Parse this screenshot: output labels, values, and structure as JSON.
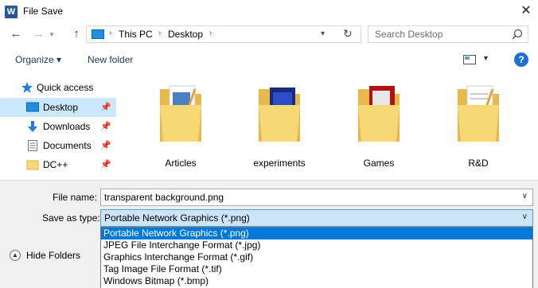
{
  "window": {
    "title": "File Save",
    "app_icon_letter": "W"
  },
  "navigation": {
    "breadcrumb": [
      "This PC",
      "Desktop"
    ],
    "search_placeholder": "Search Desktop"
  },
  "toolbar": {
    "organize_label": "Organize ▾",
    "new_folder_label": "New folder"
  },
  "sidebar": {
    "items": [
      {
        "label": "Quick access",
        "icon": "star-icon"
      },
      {
        "label": "Desktop",
        "icon": "desktop-icon",
        "selected": true
      },
      {
        "label": "Downloads",
        "icon": "download-icon"
      },
      {
        "label": "Documents",
        "icon": "documents-icon"
      },
      {
        "label": "DC++",
        "icon": "folder-icon"
      }
    ]
  },
  "files": [
    {
      "label": "Articles"
    },
    {
      "label": "experiments"
    },
    {
      "label": "Games"
    },
    {
      "label": "R&D"
    }
  ],
  "form": {
    "file_name_label": "File name:",
    "file_name_value": "transparent background.png",
    "save_as_type_label": "Save as type:",
    "save_as_type_value": "Portable Network Graphics (*.png)",
    "type_options": [
      "Portable Network Graphics (*.png)",
      "JPEG File Interchange Format (*.jpg)",
      "Graphics Interchange Format (*.gif)",
      "Tag Image File Format (*.tif)",
      "Windows Bitmap (*.bmp)"
    ],
    "hide_folders_label": "Hide Folders"
  },
  "colors": {
    "accent": "#0078d7",
    "selection": "#cce8ff",
    "folder": "#f8d775"
  }
}
